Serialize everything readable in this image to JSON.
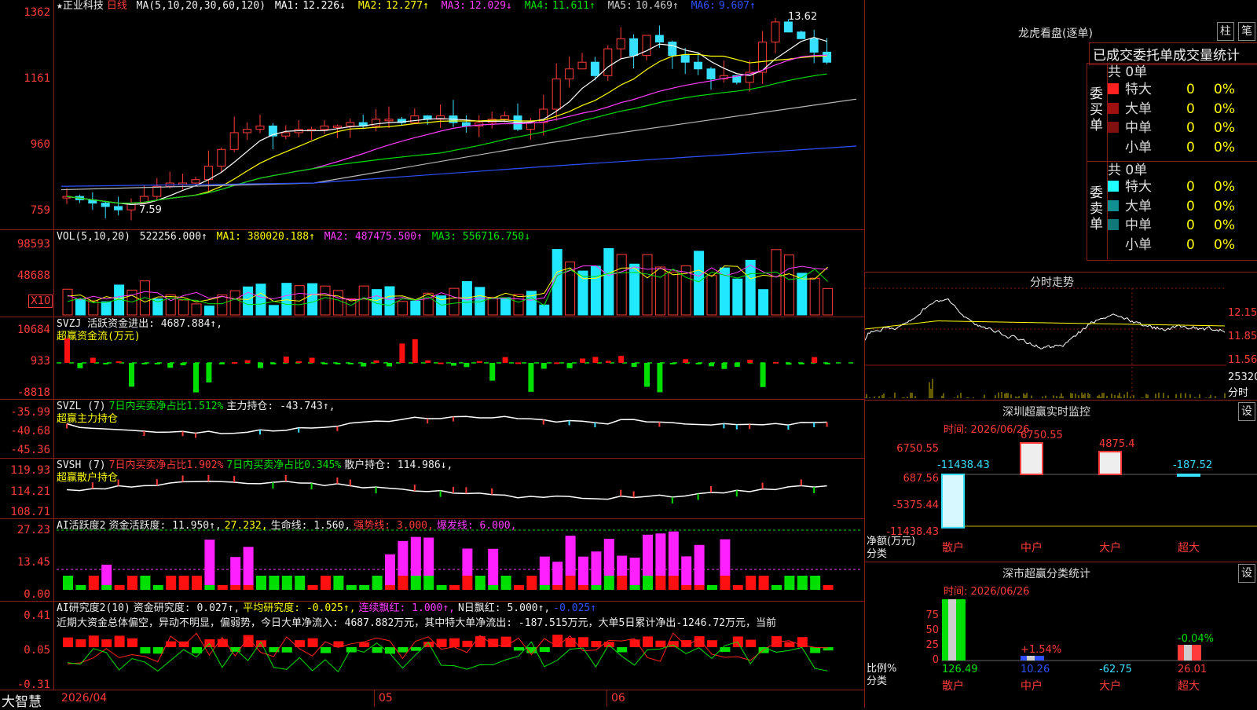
{
  "main_chart": {
    "stock": "★正业科技",
    "period": "日线",
    "ma_label": "MA(5,10,20,30,60,120)",
    "ma": [
      {
        "name": "MA1:",
        "value": "12.226↓",
        "color": "#ffffff"
      },
      {
        "name": "MA2:",
        "value": "12.277↑",
        "color": "#ffff00"
      },
      {
        "name": "MA3:",
        "value": "12.029↓",
        "color": "#ff3cff"
      },
      {
        "name": "MA4:",
        "value": "11.611↑",
        "color": "#00e000"
      },
      {
        "name": "MA5:",
        "value": "10.469↑",
        "color": "#cccccc"
      },
      {
        "name": "MA6:",
        "value": "9.607↑",
        "color": "#3050ff"
      }
    ],
    "yticks": [
      "1362",
      "1161",
      "960",
      "759"
    ],
    "high_label": "13.62",
    "low_label": "7.59"
  },
  "vol_panel": {
    "label": "VOL(5,10,20)",
    "value": "522256.000↑",
    "ma1": "MA1: 380020.188↑",
    "ma2": "MA2: 487475.500↑",
    "ma3": "MA3: 556716.750↓",
    "yticks": [
      "98593",
      "48688"
    ],
    "unit": "X10"
  },
  "svzj_panel": {
    "label": "SVZJ 活跃资金进出: 4687.884↑,",
    "sub": "超赢资金流(万元)",
    "yticks": [
      "10684",
      "933",
      "-8818"
    ]
  },
  "svzl_panel": {
    "label": "SVZL (7)",
    "a": "7日内买卖净占比1.512%",
    "b": "主力持仓: -43.743↑,",
    "sub": "超赢主力持仓",
    "yticks": [
      "-35.99",
      "-40.68",
      "-45.36"
    ]
  },
  "svsh_panel": {
    "label": "SVSH (7)",
    "a": "7日内买卖净占比1.902%",
    "b": "7日内买卖净占比0.345%",
    "c": "散户持仓: 114.986↓,",
    "sub": "超赢散户持仓",
    "yticks": [
      "119.93",
      "114.21",
      "108.71"
    ]
  },
  "ai_active": {
    "label": "AI活跃度2",
    "a": "资金活跃度: 11.950↑,",
    "b": "27.232,",
    "c": "生命线: 1.560,",
    "d": "强势线: 3.000,",
    "e": "爆发线: 6.000,",
    "yticks": [
      "27.23",
      "13.45",
      "0.00"
    ]
  },
  "ai_research": {
    "label": "AI研究度2(10)",
    "a": "资金研究度: 0.027↑,",
    "b": "平均研究度: -0.025↑,",
    "c": "连续飘红: 1.000↑,",
    "d": "N日飘红: 5.000↑,",
    "e": "-0.025↑",
    "note": "近期大资金总体偏空，异动不明显，偏弱势，今日大单净流入: 4687.882万元，其中特大单净流出: -187.515万元，大单5日累计净出-1246.72万元，当前",
    "yticks": [
      "0.41",
      "0.05",
      "-0.31"
    ]
  },
  "bottom": {
    "brand": "大智慧",
    "dates": [
      "2026/04",
      "05",
      "06"
    ]
  },
  "lhb": {
    "title": "龙虎看盘(逐单)",
    "btn1": "柱",
    "btn2": "笔",
    "tab": "已成交委托单成交量统计",
    "buy_side": "委买单",
    "sell_side": "委卖单",
    "buy_total": "共 0单",
    "sell_total": "共 0单",
    "buy_rows": [
      {
        "label": "特大",
        "count": "0",
        "pct": "0%",
        "color": "#ff2020"
      },
      {
        "label": "大单",
        "count": "0",
        "pct": "0%",
        "color": "#a01010"
      },
      {
        "label": "中单",
        "count": "0",
        "pct": "0%",
        "color": "#801010"
      },
      {
        "label": "小单",
        "count": "0",
        "pct": "0%",
        "color": "#000000"
      }
    ],
    "sell_rows": [
      {
        "label": "特大",
        "count": "0",
        "pct": "0%",
        "color": "#20ffff"
      },
      {
        "label": "大单",
        "count": "0",
        "pct": "0%",
        "color": "#109090"
      },
      {
        "label": "中单",
        "count": "0",
        "pct": "0%",
        "color": "#107878"
      },
      {
        "label": "小单",
        "count": "0",
        "pct": "0%",
        "color": "#000000"
      }
    ]
  },
  "intraday": {
    "title": "分时走势",
    "yticks": [
      "12.15",
      "11.85",
      "11.56"
    ],
    "vol_tick": "25320",
    "vol_unit": "分时"
  },
  "sz_monitor": {
    "title": "深圳超赢实时监控",
    "btn": "设",
    "time": "时间: 2026/06/26",
    "yticks": [
      "6750.55",
      "687.56",
      "-5375.44",
      "-11438.43"
    ],
    "ylabel": "净额(万元)",
    "xlabel": "分类",
    "bars": [
      {
        "cat": "散户",
        "label": "-11438.43",
        "value": -11438.43
      },
      {
        "cat": "中户",
        "label": "6750.55",
        "value": 6750.55
      },
      {
        "cat": "大户",
        "label": "4875.4",
        "value": 4875.4
      },
      {
        "cat": "超大",
        "label": "-187.52",
        "value": -187.52
      }
    ]
  },
  "sz_stat": {
    "title": "深市超赢分类统计",
    "btn": "设",
    "time": "时间: 2026/06/26",
    "yticks": [
      "75",
      "50",
      "25",
      "0"
    ],
    "ylabel": "比例%",
    "xlabel": "分类",
    "bars": [
      {
        "cat": "散户",
        "value": "126.49",
        "pct": ""
      },
      {
        "cat": "中户",
        "value": "10.26",
        "pct": "+1.54%"
      },
      {
        "cat": "大户",
        "value": "-62.75",
        "pct": ""
      },
      {
        "cat": "超大",
        "value": "26.01",
        "pct": "-0.04%"
      }
    ]
  }
}
